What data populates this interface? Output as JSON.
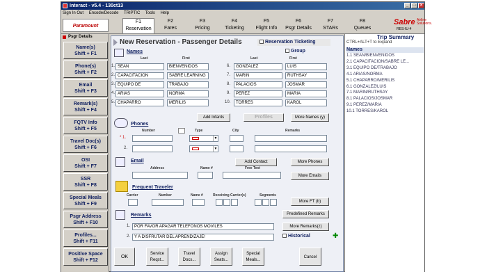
{
  "window": {
    "title": "Interact - v5.4 - 130ct13"
  },
  "menu": [
    "Sign In Out",
    "Encode/Decode",
    "TRIPTIC",
    "Tools",
    "Help"
  ],
  "logo_text": "Paramount",
  "fkeys": [
    {
      "key": "F1",
      "label": "Reservation"
    },
    {
      "key": "F2",
      "label": "Fares"
    },
    {
      "key": "F3",
      "label": "Pricing"
    },
    {
      "key": "F4",
      "label": "Ticketing"
    },
    {
      "key": "F5",
      "label": "Flight Info"
    },
    {
      "key": "F6",
      "label": "Psgr Details"
    },
    {
      "key": "F7",
      "label": "STARs"
    },
    {
      "key": "F8",
      "label": "Queues"
    }
  ],
  "sabre": {
    "name": "Sabre",
    "sub": "Airline Solutions.",
    "code": "RES-IU-4"
  },
  "sidebar": {
    "header": "Psgr Details",
    "items": [
      {
        "label": "Name(s)",
        "shortcut": "Shift + F1"
      },
      {
        "label": "Phone(s)",
        "shortcut": "Shift + F2"
      },
      {
        "label": "Email",
        "shortcut": "Shift + F3"
      },
      {
        "label": "Remark(s)",
        "shortcut": "Shift + F4"
      },
      {
        "label": "FQTV Info",
        "shortcut": "Shift + F5"
      },
      {
        "label": "Travel Doc(s)",
        "shortcut": "Shift + F6"
      },
      {
        "label": "OSI",
        "shortcut": "Shift + F7"
      },
      {
        "label": "SSR",
        "shortcut": "Shift + F8"
      },
      {
        "label": "Special Meals",
        "shortcut": "Shift + F9"
      },
      {
        "label": "Psgr Address",
        "shortcut": "Shift + F10"
      },
      {
        "label": "Profiles...",
        "shortcut": "Shift + F11"
      },
      {
        "label": "Positive Space",
        "shortcut": "Shift + F12"
      }
    ]
  },
  "form": {
    "title": "New Reservation - Passenger Details",
    "res_ticketing": "Reservation Ticketing",
    "names_label": "Names",
    "group_label": "Group",
    "last_label": "Last",
    "first_label": "First",
    "passengers": [
      {
        "n": "1.",
        "last": "SEAN",
        "first": "BIENVENIDOS"
      },
      {
        "n": "2.",
        "last": "CAPACITACION",
        "first": "SABRE LEARNING"
      },
      {
        "n": "3.",
        "last": "EQUIPO DE",
        "first": "TRABAJO"
      },
      {
        "n": "4.",
        "last": "ARIAS",
        "first": "NORMA"
      },
      {
        "n": "5.",
        "last": "CHAPARRO",
        "first": "MERILIS"
      },
      {
        "n": "6.",
        "last": "GONZALEZ",
        "first": "LUIS"
      },
      {
        "n": "7.",
        "last": "MARIN",
        "first": "RUTHSAY"
      },
      {
        "n": "8.",
        "last": "PALACIOS",
        "first": "JOSMAR"
      },
      {
        "n": "9.",
        "last": "PEREZ",
        "first": "MARIA"
      },
      {
        "n": "10.",
        "last": "TORRES",
        "first": "KAROL"
      }
    ],
    "add_infants": "Add Infants",
    "profiles": "Profiles",
    "more_names": "More Names (y)",
    "phones_label": "Phones",
    "number_label": "Number",
    "type_label": "Type",
    "city_label": "City",
    "remarks_label": "Remarks",
    "phone_rows": [
      {
        "n": "* 1."
      },
      {
        "n": "2."
      }
    ],
    "add_contact": "Add Contact",
    "more_phones": "More Phones",
    "email_label": "Email",
    "address_label": "Address",
    "name_num_label": "Name #",
    "free_text_label": "Free Text",
    "more_emails": "More Emails",
    "fqtv_label": "Frequent Traveler",
    "carrier_label": "Carrier",
    "fqtv_number_label": "Number",
    "fqtv_name_label": "Name #",
    "receiving_label": "Receiving Carrier(s)",
    "segments_label": "Segments",
    "more_ft": "More FT (b)",
    "predefined_remarks": "Predefined Remarks",
    "remarks_title": "Remarks",
    "remark_rows": [
      {
        "n": "1.",
        "text": "POR FAVOR APAGAR TELEFONOS MOVILES"
      },
      {
        "n": "2.",
        "text": "Y A DISFRUTAR DEL APRENDIZAJE!"
      }
    ],
    "more_remarks": "More Remarks(z)",
    "historical": "Historical",
    "buttons": {
      "ok": "OK",
      "service_request": "Service Reqst...",
      "travel_docs": "Travel Docs...",
      "assign_seats": "Assign Seats...",
      "special_meals": "Special Meals...",
      "cancel": "Cancel"
    }
  },
  "summary": {
    "title": "Trip Summary",
    "hint": "CTRL+ALT+T to Expand",
    "names_title": "Names",
    "names": [
      "1.1 SEAN/BIENVENIDOS",
      "2.1 CAPACITACION/SABRE LE...",
      "3.1 EQUIPO DE/TRABAJO",
      "4.1 ARIAS/NORMA",
      "5.1 CHAPARRO/MERILIS",
      "6.1 GONZALEZ/LUIS",
      "7.1 MARIN/RUTHSAY",
      "8.1 PALACIOS/JOSMAR",
      "9.1 PEREZ/MARIA",
      "10.1 TORRES/KAROL"
    ]
  }
}
